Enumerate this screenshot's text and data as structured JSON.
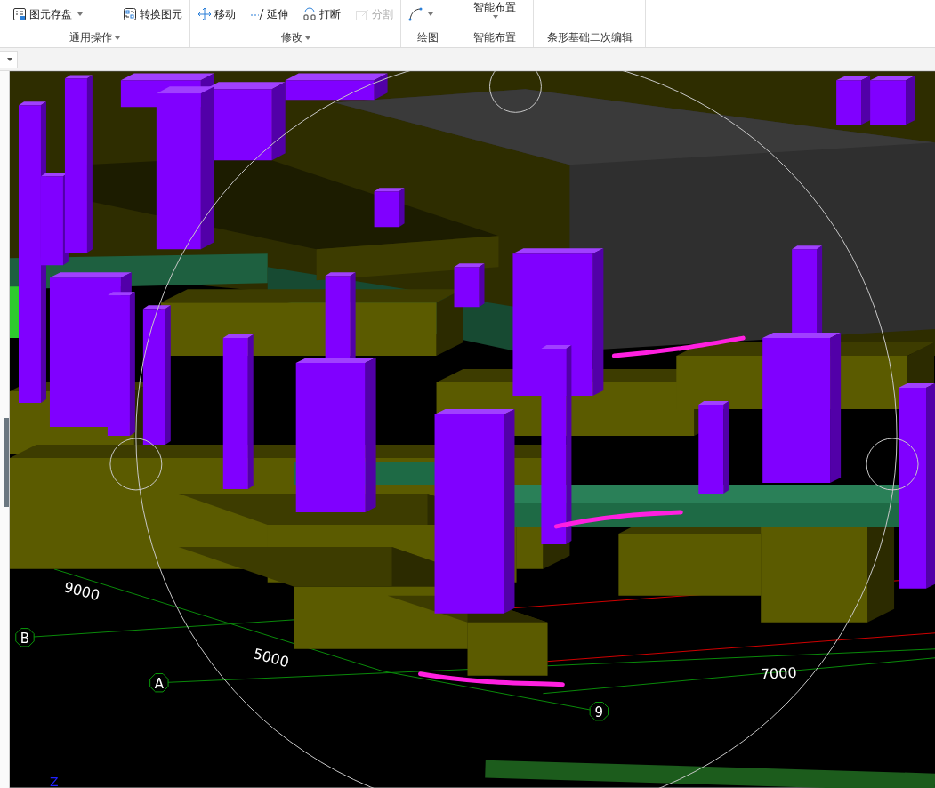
{
  "ribbon": {
    "groups": [
      {
        "label": "通用操作",
        "menu": true,
        "buttons": [
          {
            "label": "图元存盘",
            "dropdown": true,
            "disabled": false
          },
          {
            "label": "转换图元",
            "dropdown": false,
            "disabled": false
          }
        ]
      },
      {
        "label": "修改",
        "menu": true,
        "buttons": [
          {
            "label": "移动",
            "dropdown": false,
            "disabled": false
          },
          {
            "label": "延伸",
            "dropdown": false,
            "disabled": false
          },
          {
            "label": "打断",
            "dropdown": false,
            "disabled": false
          },
          {
            "label": "分割",
            "dropdown": false,
            "disabled": true
          }
        ]
      },
      {
        "label": "绘图",
        "menu": false,
        "buttons": [
          {
            "dropdown": true,
            "disabled": false
          }
        ]
      },
      {
        "label": "智能布置",
        "menu": false,
        "buttons": [
          {
            "label": "智能布置",
            "dropdown": true,
            "disabled": false
          }
        ]
      },
      {
        "label": "条形基础二次编辑",
        "menu": false
      }
    ]
  },
  "viewport": {
    "dimension_labels": [
      "9000",
      "5000",
      "7000"
    ],
    "axis_labels": [
      "B",
      "A",
      "9"
    ],
    "axis_indicator": "Z"
  }
}
